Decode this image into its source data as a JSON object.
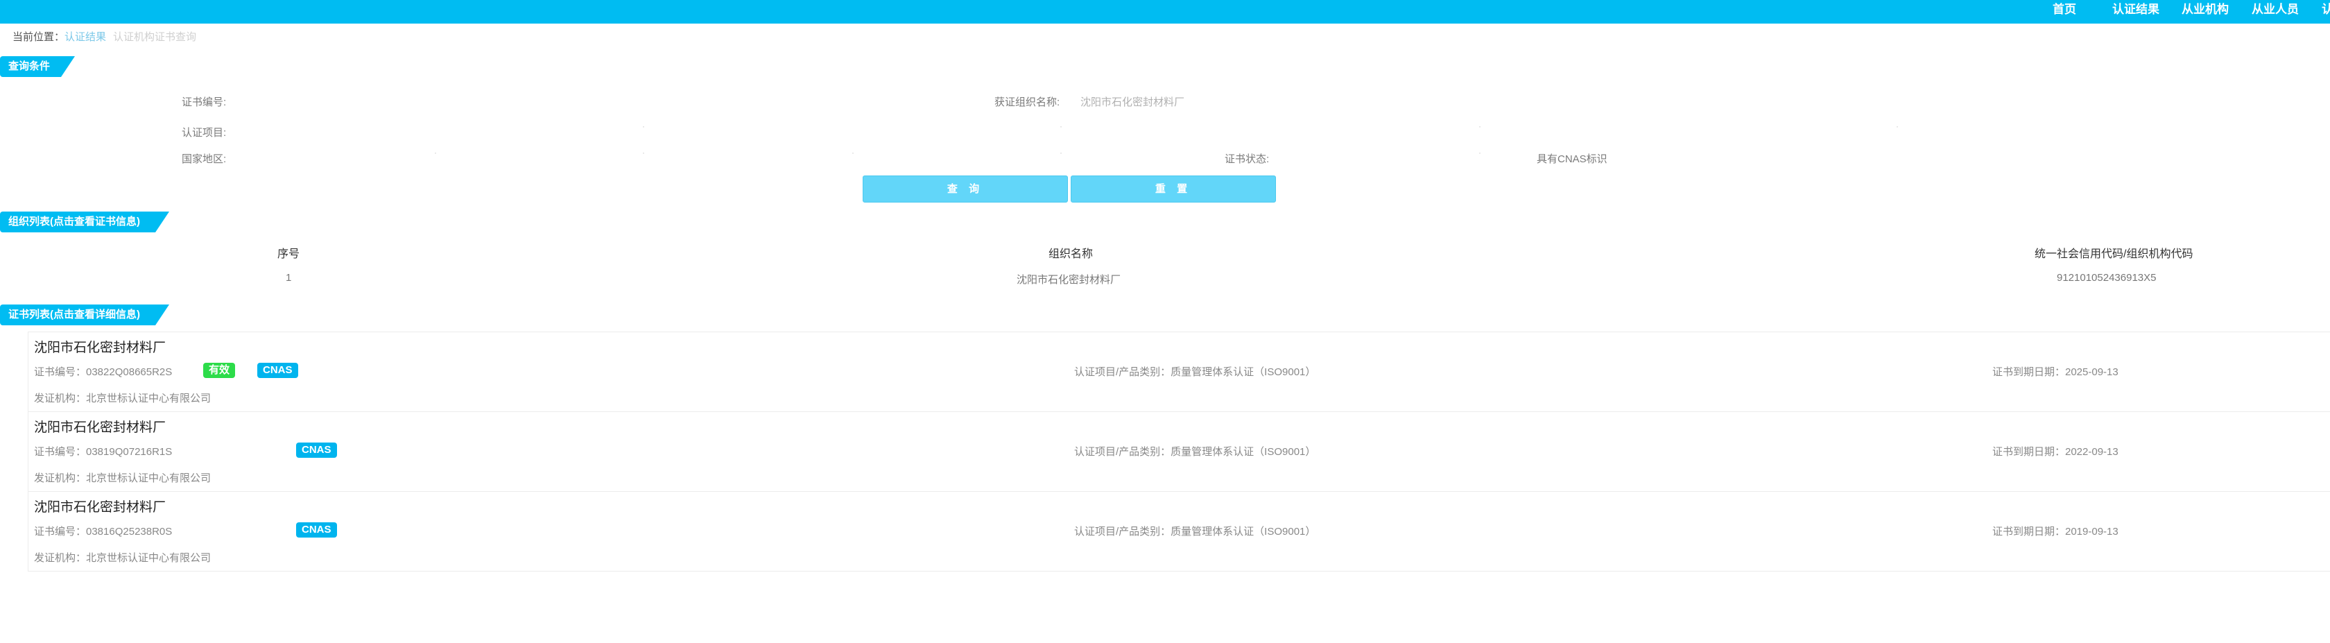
{
  "topnav": {
    "items": [
      "首页",
      "认证结果",
      "从业机构",
      "从业人员",
      "认"
    ]
  },
  "breadcrumb": {
    "prefix": "当前位置：",
    "link": "认证结果",
    "current": "认证机构证书查询"
  },
  "query": {
    "section_title": "查询条件",
    "cert_no_label": "证书编号:",
    "org_name_label": "获证组织名称:",
    "org_name_value": "沈阳市石化密封材料厂",
    "project_label": "认证项目:",
    "region_label": "国家地区:",
    "status_label": "证书状态:",
    "cnas_label": "具有CNAS标识",
    "search_button": "查 询",
    "reset_button": "重 置"
  },
  "org_list": {
    "section_title": "组织列表(点击查看证书信息)",
    "headers": [
      "序号",
      "组织名称",
      "统一社会信用代码/组织机构代码"
    ],
    "rows": [
      {
        "index": "1",
        "name": "沈阳市石化密封材料厂",
        "code": "912101052436913X5"
      }
    ]
  },
  "cert_list": {
    "section_title": "证书列表(点击查看详细信息)",
    "items": [
      {
        "org": "沈阳市石化密封材料厂",
        "cert_no": "证书编号：03822Q08665R2S",
        "status": "有效",
        "cnas": "CNAS",
        "issuer": "发证机构：北京世标认证中心有限公司",
        "project": "认证项目/产品类别：质量管理体系认证（ISO9001）",
        "expiry": "证书到期日期：2025-09-13"
      },
      {
        "org": "沈阳市石化密封材料厂",
        "cert_no": "证书编号：03819Q07216R1S",
        "status": "",
        "cnas": "CNAS",
        "issuer": "发证机构：北京世标认证中心有限公司",
        "project": "认证项目/产品类别：质量管理体系认证（ISO9001）",
        "expiry": "证书到期日期：2022-09-13"
      },
      {
        "org": "沈阳市石化密封材料厂",
        "cert_no": "证书编号：03816Q25238R0S",
        "status": "",
        "cnas": "CNAS",
        "issuer": "发证机构：北京世标认证中心有限公司",
        "project": "认证项目/产品类别：质量管理体系认证（ISO9001）",
        "expiry": "证书到期日期：2019-09-13"
      }
    ]
  },
  "colors": {
    "primary": "#00bcf2",
    "button": "#62d6f9",
    "status_valid": "#2ddc4a",
    "cnas_badge": "#00b4ee"
  }
}
